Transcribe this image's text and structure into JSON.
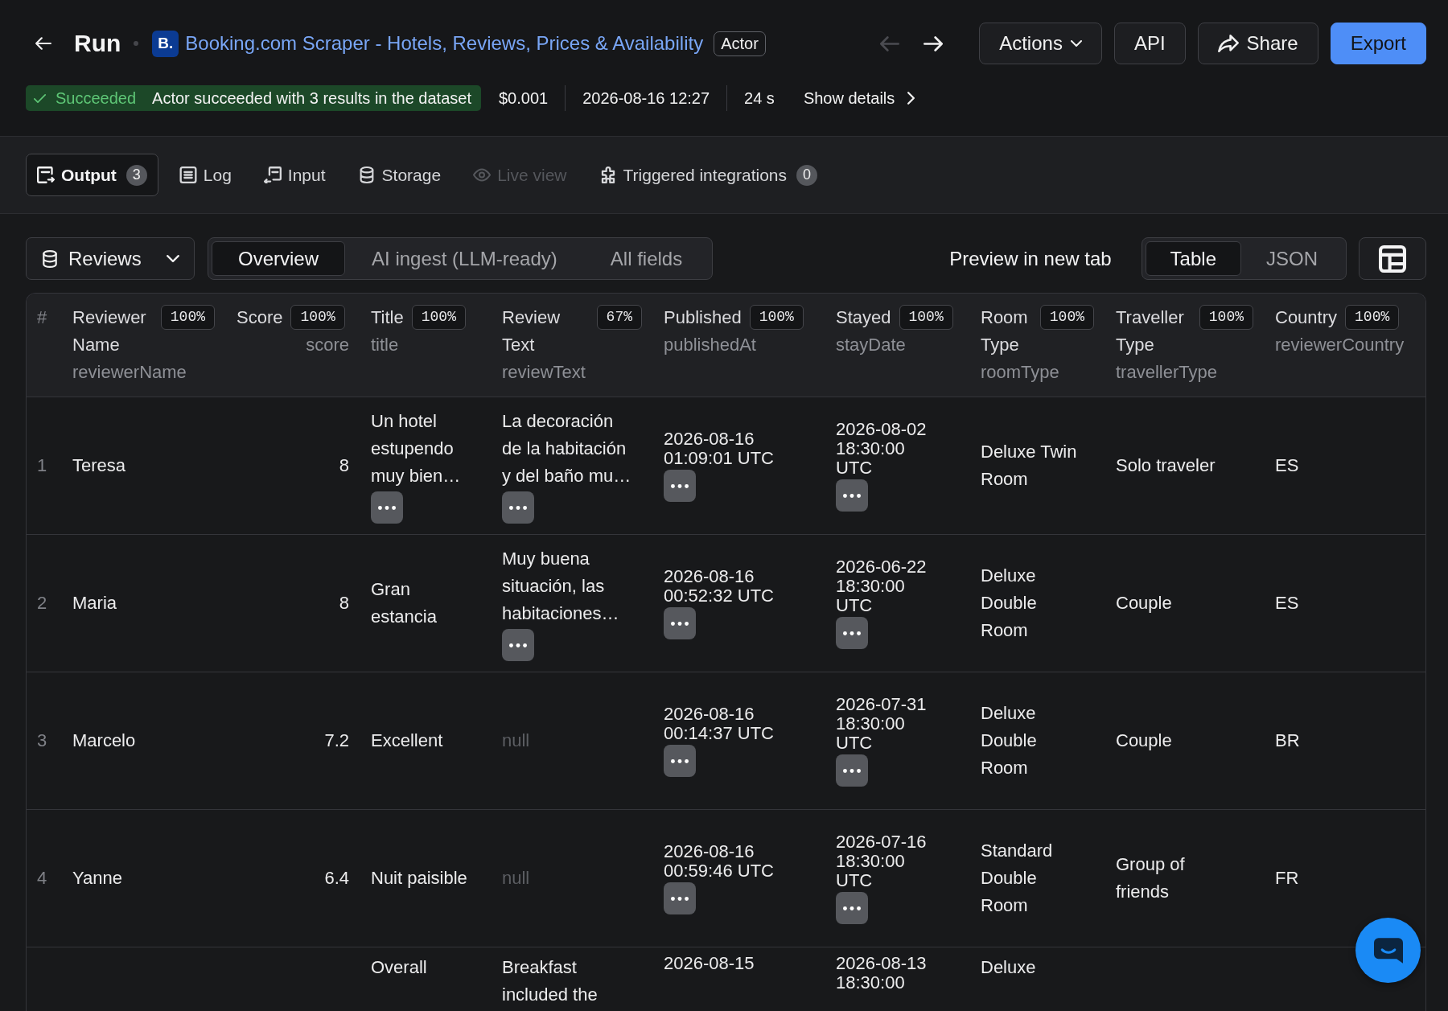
{
  "header": {
    "title": "Run",
    "actor": {
      "logo": "B.",
      "name": "Booking.com Scraper - Hotels, Reviews, Prices & Availability",
      "badge": "Actor"
    },
    "history": [
      {
        "kind": "back",
        "disabled": true
      },
      {
        "kind": "forward",
        "disabled": false
      }
    ],
    "buttons": [
      {
        "label": "Actions",
        "kind": "menu"
      },
      {
        "label": "API",
        "kind": "plain"
      },
      {
        "label": "Share",
        "kind": "share"
      },
      {
        "label": "Export",
        "kind": "primary"
      }
    ]
  },
  "status": {
    "kind": "succeeded",
    "state": "Succeeded",
    "message": "Actor succeeded with 3 results in the dataset",
    "cost": "$0.001",
    "started_at": "2026-08-16 12:27",
    "duration": "24 s",
    "details_link": "Show details"
  },
  "tabs": [
    {
      "label": "Output",
      "count": "3",
      "selected": true,
      "disabled": false
    },
    {
      "label": "Log",
      "selected": false,
      "disabled": false
    },
    {
      "label": "Input",
      "selected": false,
      "disabled": false
    },
    {
      "label": "Storage",
      "selected": false,
      "disabled": false
    },
    {
      "label": "Live view",
      "selected": false,
      "disabled": true
    },
    {
      "label": "Triggered integrations",
      "count": "0",
      "selected": false,
      "disabled": false
    }
  ],
  "toolbar": {
    "dataset": "Reviews",
    "views": [
      {
        "label": "Overview",
        "selected": true
      },
      {
        "label": "AI ingest (LLM-ready)",
        "selected": false
      },
      {
        "label": "All fields",
        "selected": false
      }
    ],
    "preview_link": "Preview in new tab",
    "formats": [
      {
        "label": "Table",
        "selected": true
      },
      {
        "label": "JSON",
        "selected": false
      }
    ]
  },
  "table": {
    "index_header": "#",
    "columns": [
      {
        "label": "Reviewer Name",
        "field": "reviewerName",
        "fill": "100%",
        "kind": "text"
      },
      {
        "label": "Score",
        "field": "score",
        "fill": "100%",
        "kind": "number"
      },
      {
        "label": "Title",
        "field": "title",
        "fill": "100%",
        "kind": "text"
      },
      {
        "label": "Review Text",
        "field": "reviewText",
        "fill": "67%",
        "kind": "text"
      },
      {
        "label": "Published",
        "field": "publishedAt",
        "fill": "100%",
        "kind": "datetime"
      },
      {
        "label": "Stayed",
        "field": "stayDate",
        "fill": "100%",
        "kind": "datetime"
      },
      {
        "label": "Room Type",
        "field": "roomType",
        "fill": "100%",
        "kind": "text"
      },
      {
        "label": "Traveller Type",
        "field": "travellerType",
        "fill": "100%",
        "kind": "text"
      },
      {
        "label": "Country",
        "field": "reviewerCountry",
        "fill": "100%",
        "kind": "text"
      }
    ],
    "rows": [
      {
        "index": "1",
        "cut_off": false,
        "cells": [
          {
            "text": "Teresa",
            "kind": "value",
            "expandable": false
          },
          {
            "text": "8",
            "kind": "value",
            "expandable": false
          },
          {
            "text": "Un hotel estupendo muy bien…",
            "kind": "value",
            "expandable": true
          },
          {
            "text": "La decoración de la habitación y del baño mu…",
            "kind": "value",
            "expandable": true
          },
          {
            "text": "2026-08-16 01:09:01 UTC",
            "kind": "value",
            "expandable": true
          },
          {
            "text": "2026-08-02 18:30:00 UTC",
            "kind": "value",
            "expandable": true
          },
          {
            "text": "Deluxe Twin Room",
            "kind": "value",
            "expandable": false
          },
          {
            "text": "Solo traveler",
            "kind": "value",
            "expandable": false
          },
          {
            "text": "ES",
            "kind": "value",
            "expandable": false
          }
        ]
      },
      {
        "index": "2",
        "cut_off": false,
        "cells": [
          {
            "text": "Maria",
            "kind": "value",
            "expandable": false
          },
          {
            "text": "8",
            "kind": "value",
            "expandable": false
          },
          {
            "text": "Gran estancia",
            "kind": "value",
            "expandable": false
          },
          {
            "text": "Muy buena situación, las habitaciones…",
            "kind": "value",
            "expandable": true
          },
          {
            "text": "2026-08-16 00:52:32 UTC",
            "kind": "value",
            "expandable": true
          },
          {
            "text": "2026-06-22 18:30:00 UTC",
            "kind": "value",
            "expandable": true
          },
          {
            "text": "Deluxe Double Room",
            "kind": "value",
            "expandable": false
          },
          {
            "text": "Couple",
            "kind": "value",
            "expandable": false
          },
          {
            "text": "ES",
            "kind": "value",
            "expandable": false
          }
        ]
      },
      {
        "index": "3",
        "cut_off": false,
        "cells": [
          {
            "text": "Marcelo",
            "kind": "value",
            "expandable": false
          },
          {
            "text": "7.2",
            "kind": "value",
            "expandable": false
          },
          {
            "text": "Excellent",
            "kind": "value",
            "expandable": false
          },
          {
            "text": "null",
            "kind": "null",
            "expandable": false
          },
          {
            "text": "2026-08-16 00:14:37 UTC",
            "kind": "value",
            "expandable": true
          },
          {
            "text": "2026-07-31 18:30:00 UTC",
            "kind": "value",
            "expandable": true
          },
          {
            "text": "Deluxe Double Room",
            "kind": "value",
            "expandable": false
          },
          {
            "text": "Couple",
            "kind": "value",
            "expandable": false
          },
          {
            "text": "BR",
            "kind": "value",
            "expandable": false
          }
        ]
      },
      {
        "index": "4",
        "cut_off": false,
        "cells": [
          {
            "text": "Yanne",
            "kind": "value",
            "expandable": false
          },
          {
            "text": "6.4",
            "kind": "value",
            "expandable": false
          },
          {
            "text": "Nuit paisible",
            "kind": "value",
            "expandable": false
          },
          {
            "text": "null",
            "kind": "null",
            "expandable": false
          },
          {
            "text": "2026-08-16 00:59:46 UTC",
            "kind": "value",
            "expandable": true
          },
          {
            "text": "2026-07-16 18:30:00 UTC",
            "kind": "value",
            "expandable": true
          },
          {
            "text": "Standard Double Room",
            "kind": "value",
            "expandable": false
          },
          {
            "text": "Group of friends",
            "kind": "value",
            "expandable": false
          },
          {
            "text": "FR",
            "kind": "value",
            "expandable": false
          }
        ]
      },
      {
        "cut_off": true,
        "cells": [
          "",
          "",
          {
            "text": "Overall",
            "kind": "value",
            "expandable": false
          },
          {
            "text": "Breakfast included the",
            "kind": "value",
            "expandable": false
          },
          {
            "text": "2026-08-15",
            "kind": "value",
            "expandable": false
          },
          {
            "text": "2026-08-13 18:30:00",
            "kind": "value",
            "expandable": false
          },
          {
            "text": "Deluxe",
            "kind": "value",
            "expandable": false
          },
          "",
          ""
        ]
      }
    ]
  }
}
